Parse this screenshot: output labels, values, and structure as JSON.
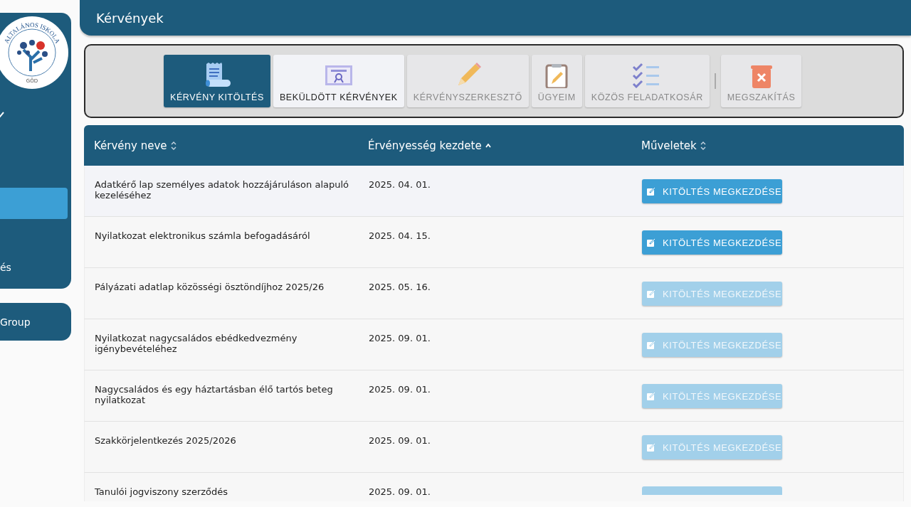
{
  "sidebar": {
    "logo": {
      "arc_text": "ALTALÁNOS ISKOLA",
      "bottom_text": "GÖD"
    },
    "items": [
      {
        "selected": true
      },
      {
        "label": "és",
        "selected": false
      }
    ],
    "group_panel": {
      "label": "Group"
    }
  },
  "header": {
    "title": "Kérvények"
  },
  "toolbar": {
    "tabs": [
      {
        "label": "KÉRVÉNY KITÖLTÉS",
        "selected": true,
        "disabled": false
      },
      {
        "label": "BEKÜLDÖTT KÉRVÉNYEK",
        "selected": false,
        "disabled": false
      },
      {
        "label": "KÉRVÉNYSZERKESZTŐ",
        "selected": false,
        "disabled": true
      },
      {
        "label": "ÜGYEIM",
        "selected": false,
        "disabled": true
      },
      {
        "label": "KÖZÖS FELADATKOSÁR",
        "selected": false,
        "disabled": true
      },
      {
        "label": "MEGSZAKÍTÁS",
        "selected": false,
        "disabled": true
      }
    ]
  },
  "table": {
    "columns": [
      {
        "label": "Kérvény neve",
        "sorted_ascending": false
      },
      {
        "label": "Érvényesség kezdete",
        "sorted_ascending": true
      },
      {
        "label": "Műveletek",
        "sorted_ascending": false
      }
    ],
    "rows": [
      {
        "name": "Adatkérő lap személyes adatok hozzájáruláson alapuló kezeléséhez",
        "start": "2025. 04. 01.",
        "action": "KITÖLTÉS MEGKEZDÉSE",
        "disabled": false
      },
      {
        "name": "Nyilatkozat elektronikus számla befogadásáról",
        "start": "2025. 04. 15.",
        "action": "KITÖLTÉS MEGKEZDÉSE",
        "disabled": false
      },
      {
        "name": "Pályázati adatlap közösségi ösztöndíjhoz 2025/26",
        "start": "2025. 05. 16.",
        "action": "KITÖLTÉS MEGKEZDÉSE",
        "disabled": true
      },
      {
        "name": "Nyilatkozat nagycsaládos ebédkedvezmény igénybevételéhez",
        "start": "2025. 09. 01.",
        "action": "KITÖLTÉS MEGKEZDÉSE",
        "disabled": true
      },
      {
        "name": "Nagycsaládos és egy háztartásban élő tartós beteg nyilatkozat",
        "start": "2025. 09. 01.",
        "action": "KITÖLTÉS MEGKEZDÉSE",
        "disabled": true
      },
      {
        "name": "Szakkörjelentkezés 2025/2026",
        "start": "2025. 09. 01.",
        "action": "KITÖLTÉS MEGKEZDÉSE",
        "disabled": true
      },
      {
        "name": "Tanulói jogviszony szerződés",
        "start": "2025. 09. 01.",
        "disabled": true
      }
    ]
  }
}
